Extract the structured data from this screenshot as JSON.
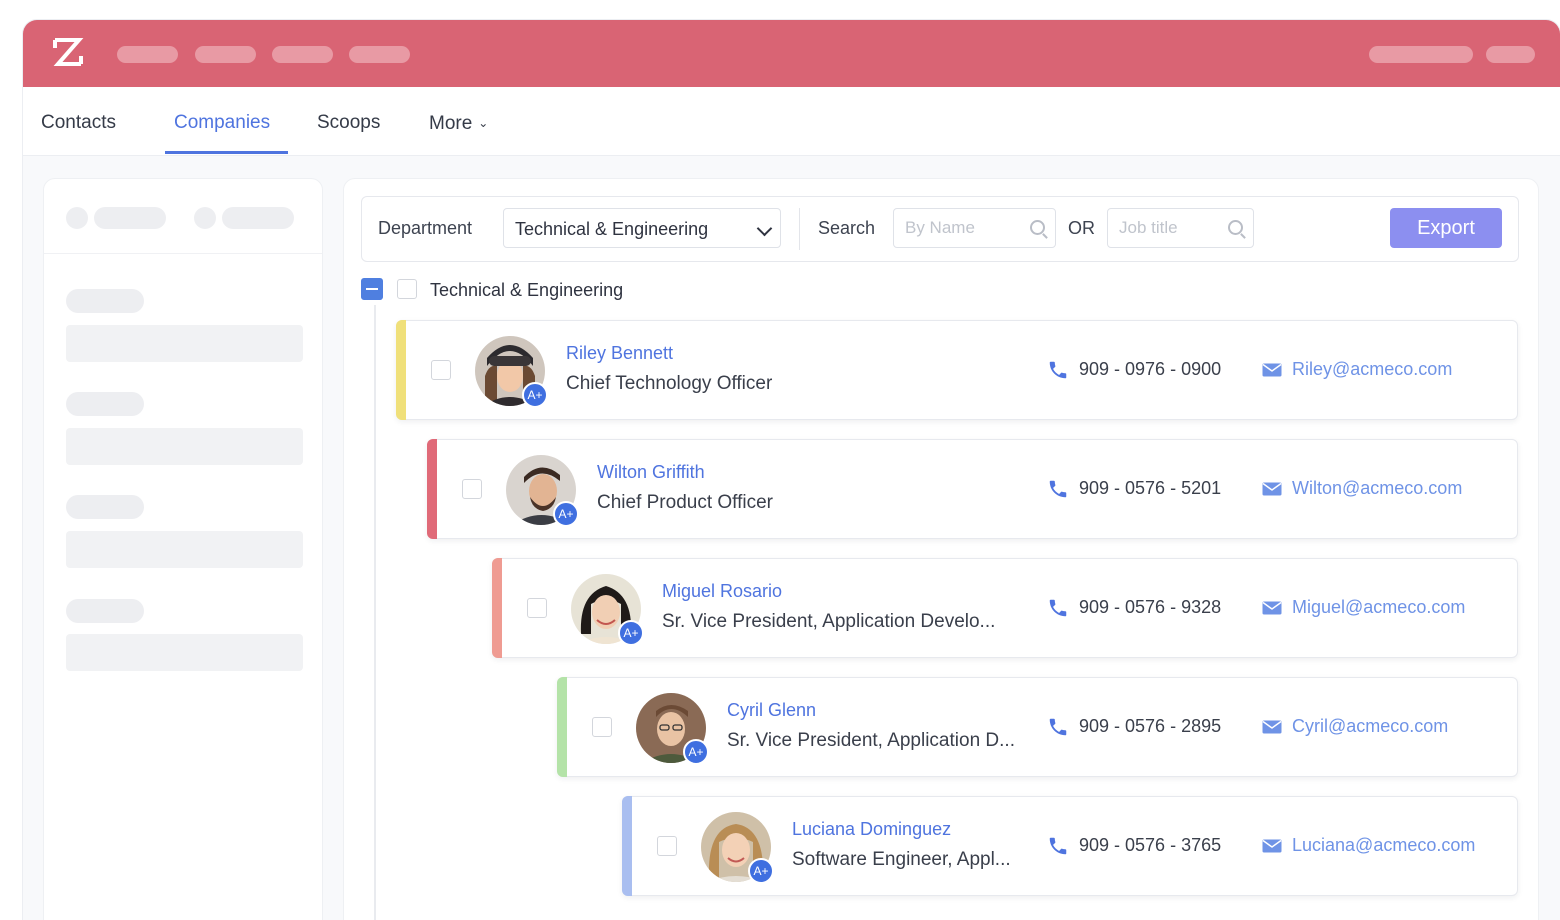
{
  "tabs": [
    {
      "label": "Contacts"
    },
    {
      "label": "Companies"
    },
    {
      "label": "Scoops"
    },
    {
      "label": "More"
    }
  ],
  "active_tab": "Companies",
  "filters": {
    "department_label": "Department",
    "department_value": "Technical & Engineering",
    "search_label": "Search",
    "name_placeholder": "By Name",
    "or_label": "OR",
    "title_placeholder": "Job title",
    "export_label": "Export"
  },
  "department": {
    "name": "Technical & Engineering"
  },
  "contacts": [
    {
      "name": "Riley Bennett",
      "title": "Chief Technology Officer",
      "phone": "909 - 0976 - 0900",
      "email": "Riley@acmeco.com",
      "badge": "A+",
      "stripe_color": "#f0e07a"
    },
    {
      "name": "Wilton Griffith",
      "title": "Chief Product Officer",
      "phone": "909 - 0576 - 5201",
      "email": "Wilton@acmeco.com",
      "badge": "A+",
      "stripe_color": "#e06a78"
    },
    {
      "name": "Miguel Rosario",
      "title": "Sr. Vice President, Application Develo...",
      "phone": "909 - 0576 - 9328",
      "email": "Miguel@acmeco.com",
      "badge": "A+",
      "stripe_color": "#ef9b92"
    },
    {
      "name": "Cyril Glenn",
      "title": "Sr. Vice President, Application D...",
      "phone": "909 - 0576 - 2895",
      "email": "Cyril@acmeco.com",
      "badge": "A+",
      "stripe_color": "#b4e3a8"
    },
    {
      "name": "Luciana Dominguez",
      "title": "Software Engineer, Appl...",
      "phone": "909 - 0576 - 3765",
      "email": "Luciana@acmeco.com",
      "badge": "A+",
      "stripe_color": "#a9bef0"
    }
  ],
  "colors": {
    "brand_bar": "#d96474",
    "accent": "#4f74df",
    "export_button": "#8c8ff0"
  }
}
